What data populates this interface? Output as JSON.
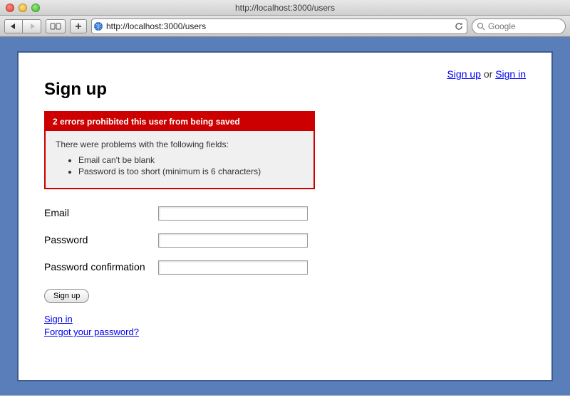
{
  "browser": {
    "title": "http://localhost:3000/users",
    "url": "http://localhost:3000/users",
    "search_placeholder": "Google"
  },
  "topnav": {
    "signup": "Sign up",
    "or": " or ",
    "signin": "Sign in"
  },
  "heading": "Sign up",
  "error": {
    "header": "2 errors prohibited this user from being saved",
    "intro": "There were problems with the following fields:",
    "items": [
      "Email can't be blank",
      "Password is too short (minimum is 6 characters)"
    ]
  },
  "form": {
    "email_label": "Email",
    "password_label": "Password",
    "confirm_label": "Password confirmation",
    "submit_label": "Sign up"
  },
  "links": {
    "signin": "Sign in",
    "forgot": "Forgot your password?"
  }
}
